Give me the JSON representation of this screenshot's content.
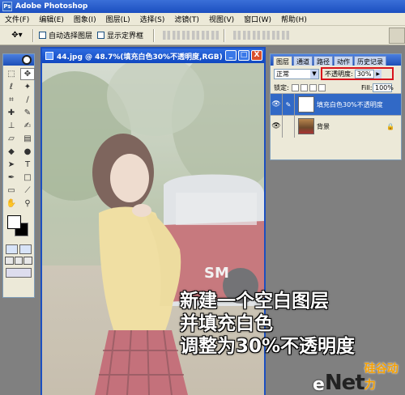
{
  "app": {
    "title": "Adobe Photoshop",
    "icon_label": "Ps"
  },
  "menu": [
    "文件(F)",
    "编辑(E)",
    "图象(I)",
    "图层(L)",
    "选择(S)",
    "滤镜(T)",
    "视图(V)",
    "窗口(W)",
    "帮助(H)"
  ],
  "options": {
    "auto_select_layer": "自动选择图层",
    "show_bounding_box": "显示定界框"
  },
  "document": {
    "title": "44.jpg @ 48.7%(填充白色30%不透明度,RGB)",
    "buttons": {
      "minimize": "_",
      "maximize": "□",
      "close": "X"
    }
  },
  "layers_panel": {
    "tabs": [
      "图层",
      "通道",
      "路径",
      "动作",
      "历史记录"
    ],
    "blend_mode": "正常",
    "opacity_label": "不透明度:",
    "opacity_value": "30%",
    "lock_label": "锁定:",
    "fill_label": "Fill:",
    "fill_value": "100%",
    "layers": [
      {
        "name": "填充白色30%不透明度",
        "selected": true
      },
      {
        "name": "背景",
        "selected": false
      }
    ]
  },
  "caption": [
    "新建一个空白图层",
    "并填充白色",
    "调整为30%不透明度"
  ],
  "watermark": {
    "e": "e",
    "net": "Net",
    "cn": "硅谷动力"
  },
  "colors": {
    "titlebar": "#1c4fc0",
    "selected_layer": "#3169c6",
    "highlight_border": "#d8141c"
  }
}
